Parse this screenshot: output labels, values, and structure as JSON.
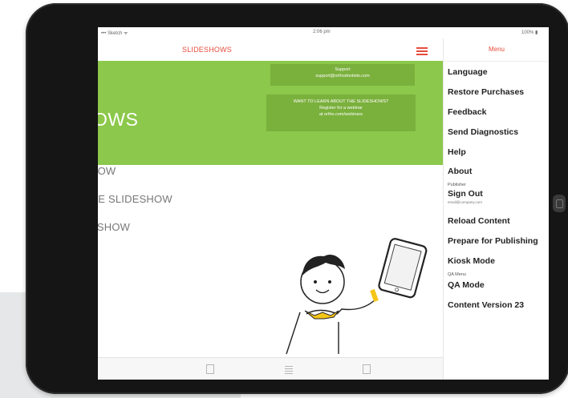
{
  "status_bar": {
    "carrier": "••• Sketch ᯤ",
    "time": "2:06 pm",
    "battery": "100% ▮"
  },
  "header": {
    "title": "SLIDESHOWS"
  },
  "banner": {
    "title": "OWS",
    "box1_line1": "Support",
    "box1_line2": "support@orthodontists.com",
    "box2_line1": "WANT TO LEARN ABOUT THE SLIDESHOWS?",
    "box2_line2": "Register for a webinar",
    "box2_line3": "at ortho.com/webinars"
  },
  "slideshows": [
    {
      "label": "HOW"
    },
    {
      "label": "GE SLIDESHOW"
    },
    {
      "label": "ESHOW"
    }
  ],
  "menu": {
    "header": "Menu",
    "items": {
      "language": "Language",
      "restore_purchases": "Restore Purchases",
      "feedback": "Feedback",
      "send_diagnostics": "Send Diagnostics",
      "help": "Help",
      "about": "About",
      "publisher_caption": "Publisher",
      "sign_out": "Sign Out",
      "sign_out_email": "email@company.com",
      "reload_content": "Reload Content",
      "prepare_for_publishing": "Prepare for Publishing",
      "kiosk_mode": "Kiosk Mode",
      "qa_menu_caption": "QA Menu",
      "qa_mode": "QA Mode",
      "content_version": "Content Version 23"
    }
  },
  "colors": {
    "accent": "#e74c3c",
    "banner_green": "#8cc84b",
    "banner_box": "#7ab03c",
    "device_frame": "#151515",
    "character_collar": "#f5c518"
  },
  "icons": {
    "menu": "hamburger-icon",
    "tab1": "pages-icon",
    "tab2": "list-icon",
    "tab3": "document-icon"
  }
}
